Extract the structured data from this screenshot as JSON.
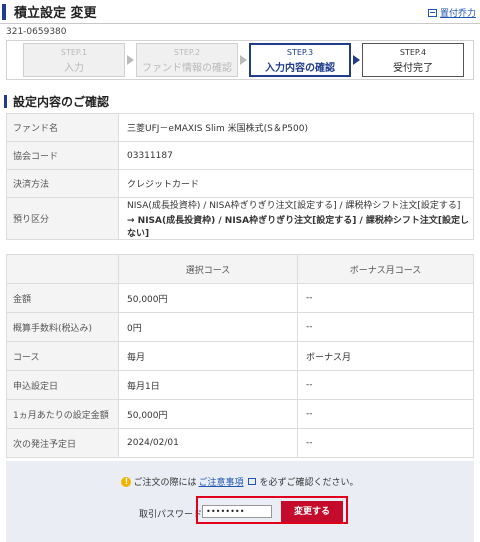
{
  "header": {
    "title": "積立設定 変更",
    "batch_print": "置付乔力"
  },
  "order_id": "321-0659380",
  "steps": [
    {
      "num": "STEP.1",
      "label": "入力",
      "state": "done"
    },
    {
      "num": "STEP.2",
      "label": "ファンド情報の確認",
      "state": "done"
    },
    {
      "num": "STEP.3",
      "label": "入力内容の確認",
      "state": "active"
    },
    {
      "num": "STEP.4",
      "label": "受付完了",
      "state": "future"
    }
  ],
  "section_title": "設定内容のご確認",
  "info": {
    "fund_label": "ファンド名",
    "fund_value": "三菱UFJ－eMAXIS Slim 米国株式(S＆P500)",
    "code_label": "協会コード",
    "code_value": "03311187",
    "payment_label": "決済方法",
    "payment_value": "クレジットカード",
    "deposit_label": "預り区分",
    "deposit_line1": "NISA(成長投資枠) / NISA枠ぎりぎり注文[設定する] / 課税枠シフト注文[設定する]",
    "deposit_line2": "→ NISA(成長投資枠) / NISA枠ぎりぎり注文[設定する] / 課税枠シフト注文[設定しない]"
  },
  "course_table": {
    "headers": [
      "",
      "選択コース",
      "ボーナス月コース"
    ],
    "rows": [
      {
        "label": "金額",
        "selected": "50,000円",
        "bonus": "--"
      },
      {
        "label": "概算手数料(税込み)",
        "selected": "0円",
        "bonus": "--"
      },
      {
        "label": "コース",
        "selected": "毎月",
        "bonus": "ボーナス月"
      },
      {
        "label": "申込設定日",
        "selected": "毎月1日",
        "bonus": "--"
      },
      {
        "label": "1ヵ月あたりの設定金額",
        "selected": "50,000円",
        "bonus": "--"
      },
      {
        "label": "次の発注予定日",
        "selected": "2024/02/01",
        "bonus": "--"
      }
    ]
  },
  "confirm": {
    "notice_before": "ご注文の際には",
    "notice_link": "ご注意事項",
    "notice_after": "を必ずご確認ください。",
    "password_label": "取引パスワード",
    "password_value": "••••••••",
    "submit_label": "変更する"
  },
  "colors": {
    "accent": "#1f3d8c",
    "submit": "#c40b2c",
    "highlight": "#e0001b"
  }
}
